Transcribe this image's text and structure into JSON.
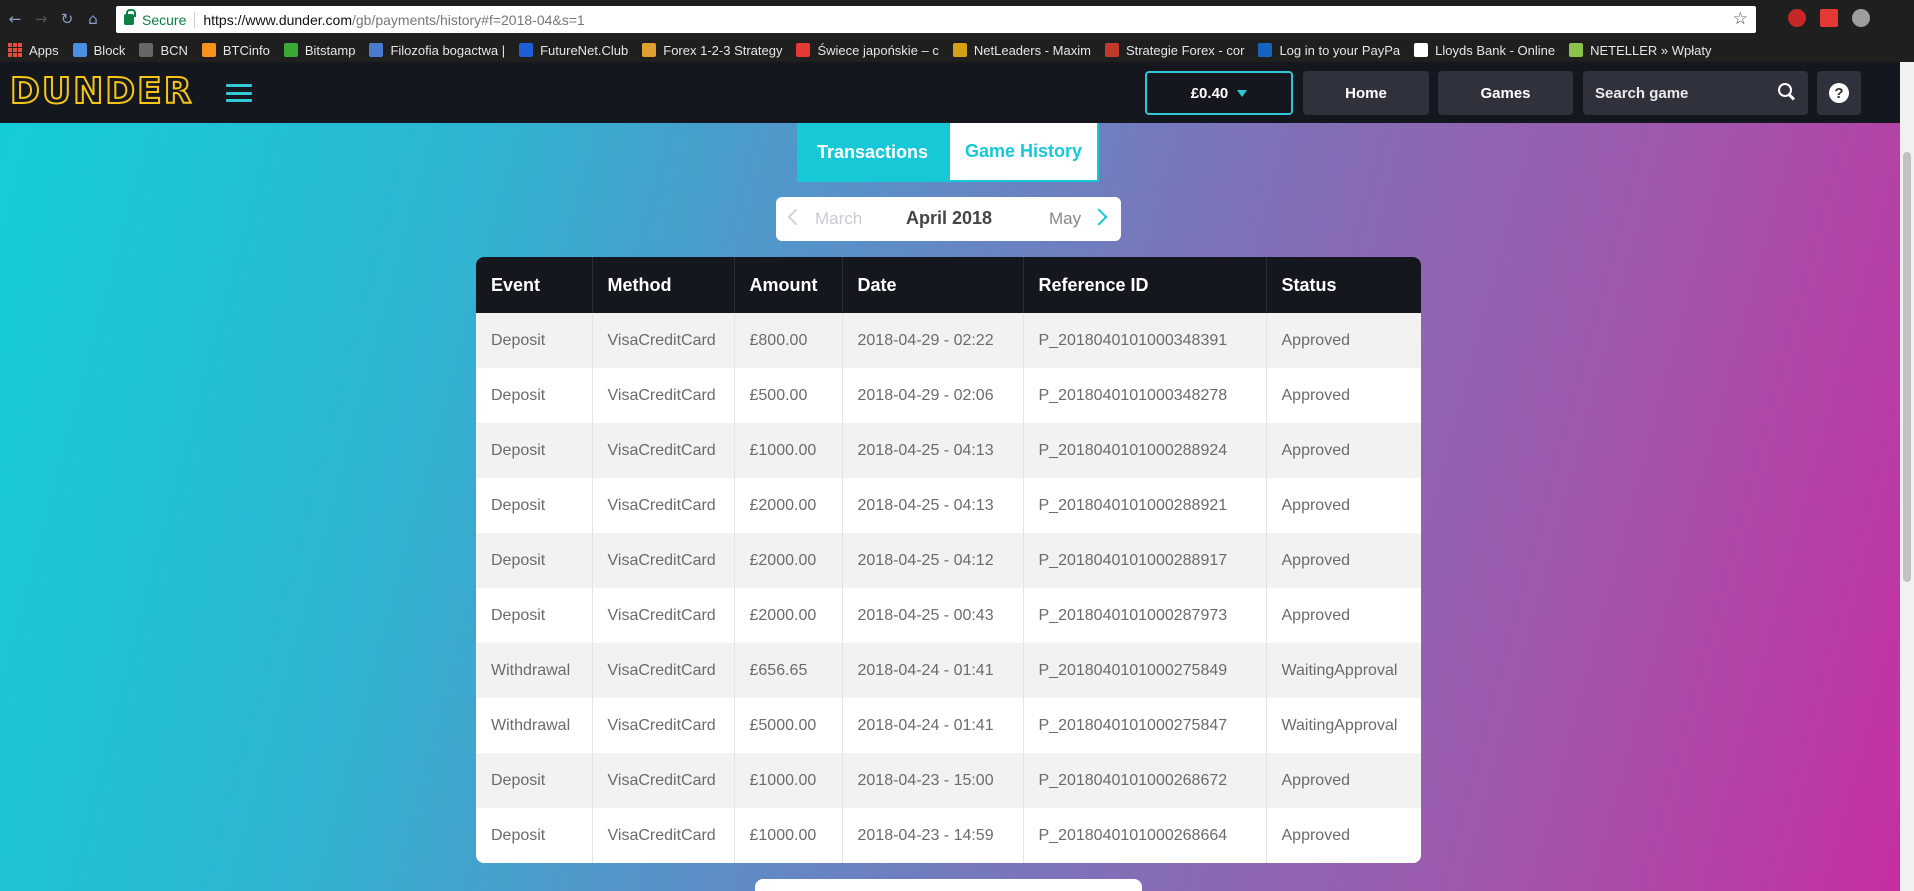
{
  "browser": {
    "secure_label": "Secure",
    "url_host": "https://www.dunder.com",
    "url_path": "/gb/payments/history#f=2018-04&s=1",
    "bookmarks": [
      {
        "label": "Apps",
        "color": "#e84c3d"
      },
      {
        "label": "Block",
        "color": "#4a90e2"
      },
      {
        "label": "BCN",
        "color": "#666666"
      },
      {
        "label": "BTCinfo",
        "color": "#f7931a"
      },
      {
        "label": "Bitstamp",
        "color": "#3aa935"
      },
      {
        "label": "Filozofia bogactwa |",
        "color": "#4a7bd0"
      },
      {
        "label": "FutureNet.Club",
        "color": "#1e5fd8"
      },
      {
        "label": "Forex 1-2-3 Strategy",
        "color": "#e0a030"
      },
      {
        "label": "Świece japońskie – c",
        "color": "#e53935"
      },
      {
        "label": "NetLeaders - Maxim",
        "color": "#d4a017"
      },
      {
        "label": "Strategie Forex - cor",
        "color": "#c0392b"
      },
      {
        "label": "Log in to your PayPa",
        "color": "#1565c0"
      },
      {
        "label": "Lloyds Bank - Online",
        "color": "#ffffff"
      },
      {
        "label": "NETELLER » Wpłaty",
        "color": "#8bc34a"
      }
    ]
  },
  "header": {
    "logo": "DUNDER",
    "balance": "£0.40",
    "home_label": "Home",
    "games_label": "Games",
    "search_placeholder": "Search game",
    "help_label": "?"
  },
  "tabs": {
    "transactions": "Transactions",
    "game_history": "Game History"
  },
  "month_nav": {
    "prev": "March",
    "current": "April 2018",
    "next": "May"
  },
  "table": {
    "headers": [
      "Event",
      "Method",
      "Amount",
      "Date",
      "Reference ID",
      "Status"
    ],
    "rows": [
      [
        "Deposit",
        "VisaCreditCard",
        "£800.00",
        "2018-04-29 - 02:22",
        "P_2018040101000348391",
        "Approved"
      ],
      [
        "Deposit",
        "VisaCreditCard",
        "£500.00",
        "2018-04-29 - 02:06",
        "P_2018040101000348278",
        "Approved"
      ],
      [
        "Deposit",
        "VisaCreditCard",
        "£1000.00",
        "2018-04-25 - 04:13",
        "P_2018040101000288924",
        "Approved"
      ],
      [
        "Deposit",
        "VisaCreditCard",
        "£2000.00",
        "2018-04-25 - 04:13",
        "P_2018040101000288921",
        "Approved"
      ],
      [
        "Deposit",
        "VisaCreditCard",
        "£2000.00",
        "2018-04-25 - 04:12",
        "P_2018040101000288917",
        "Approved"
      ],
      [
        "Deposit",
        "VisaCreditCard",
        "£2000.00",
        "2018-04-25 - 00:43",
        "P_2018040101000287973",
        "Approved"
      ],
      [
        "Withdrawal",
        "VisaCreditCard",
        "£656.65",
        "2018-04-24 - 01:41",
        "P_2018040101000275849",
        "WaitingApproval"
      ],
      [
        "Withdrawal",
        "VisaCreditCard",
        "£5000.00",
        "2018-04-24 - 01:41",
        "P_2018040101000275847",
        "WaitingApproval"
      ],
      [
        "Deposit",
        "VisaCreditCard",
        "£1000.00",
        "2018-04-23 - 15:00",
        "P_2018040101000268672",
        "Approved"
      ],
      [
        "Deposit",
        "VisaCreditCard",
        "£1000.00",
        "2018-04-23 - 14:59",
        "P_2018040101000268664",
        "Approved"
      ]
    ]
  },
  "colors": {
    "accent": "#17c8d6",
    "logo": "#f5c518",
    "header_bg": "#15171f"
  }
}
